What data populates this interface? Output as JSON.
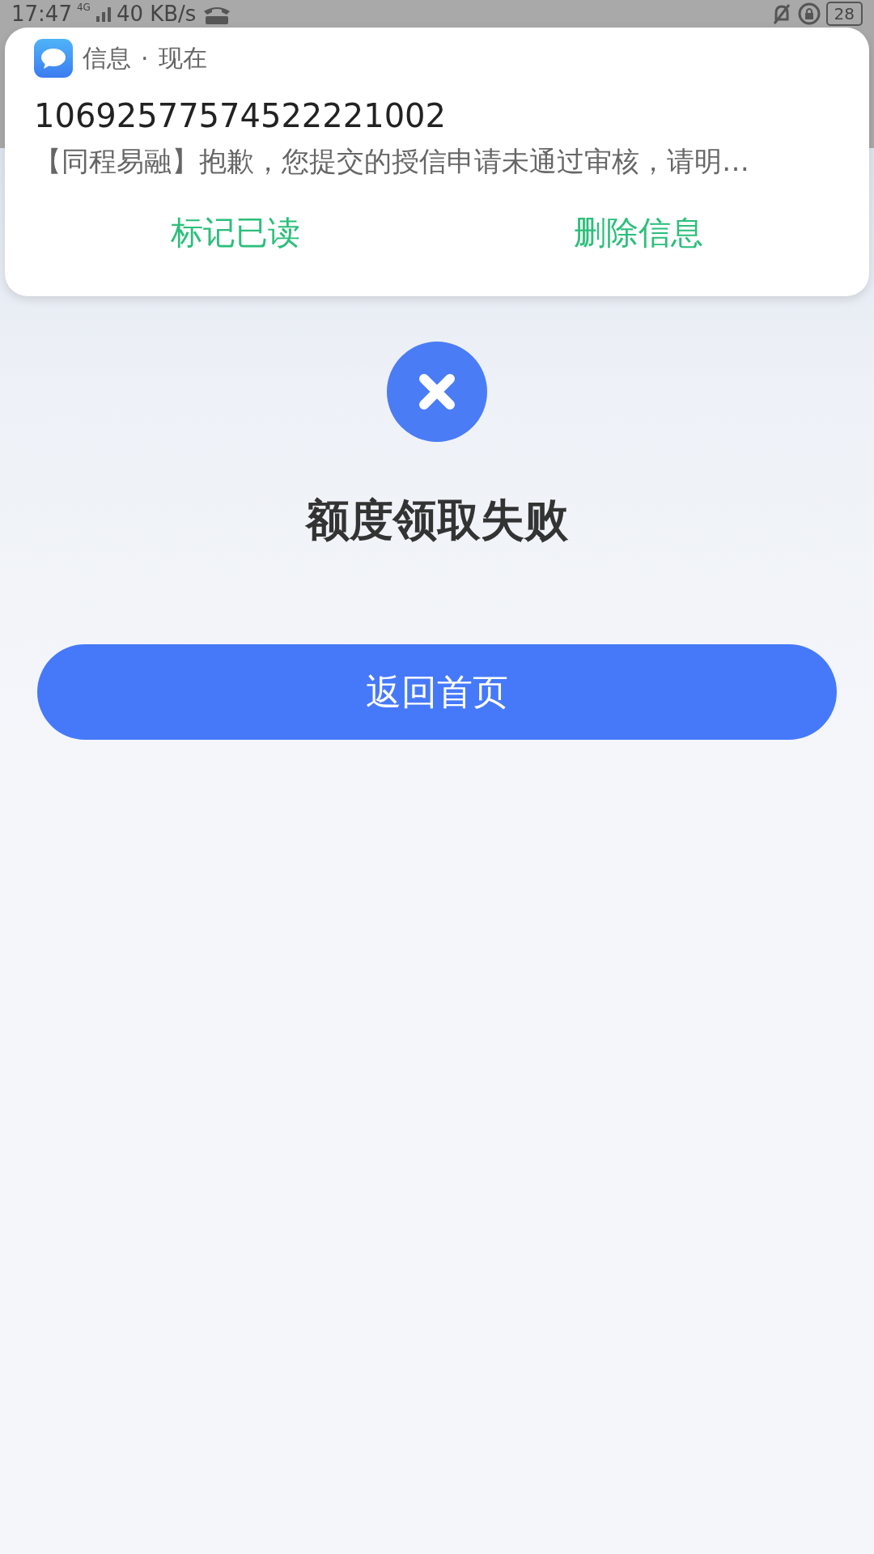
{
  "status_bar": {
    "time": "17:47",
    "network": "4G",
    "speed": "40 KB/s",
    "battery": "28"
  },
  "notification": {
    "app": "信息",
    "separator": "·",
    "time": "现在",
    "sender": "10692577574522221002",
    "message": "【同程易融】抱歉，您提交的授信申请未通过审核，请明…",
    "actions": [
      "标记已读",
      "删除信息"
    ]
  },
  "result": {
    "title": "额度领取失败",
    "button": "返回首页"
  }
}
